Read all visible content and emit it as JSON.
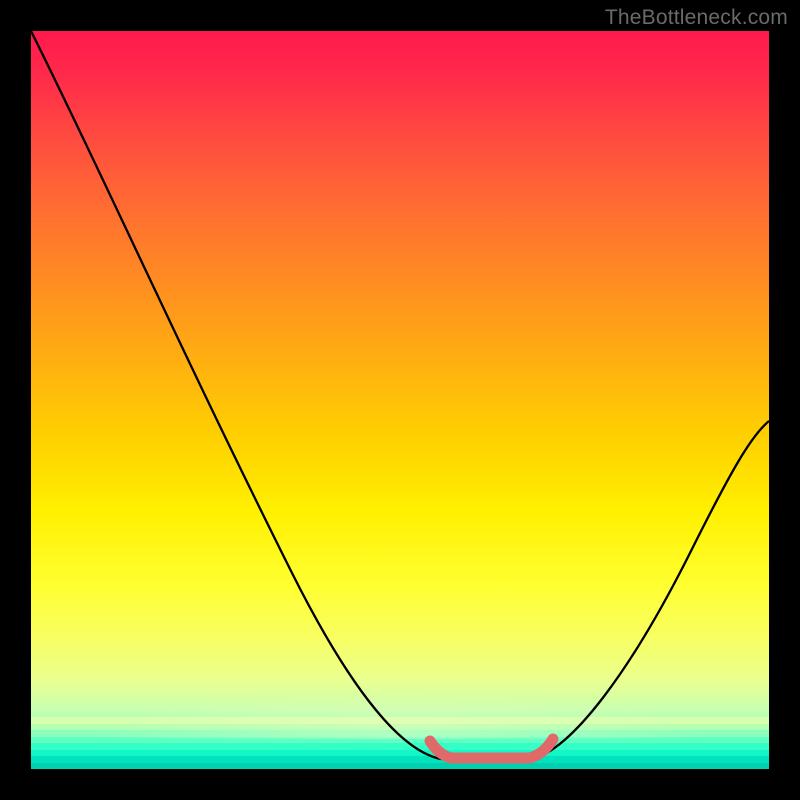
{
  "watermark": "TheBottleneck.com",
  "colors": {
    "frame": "#000000",
    "curve": "#000000",
    "marker": "#e57373",
    "gradient": [
      "#ff1a4d",
      "#ff4d3f",
      "#ff9020",
      "#ffd000",
      "#fff000",
      "#f8ff60",
      "#8effc0",
      "#00ffcc"
    ]
  },
  "chart_data": {
    "type": "line",
    "title": "",
    "xlabel": "",
    "ylabel": "",
    "xlim": [
      0,
      100
    ],
    "ylim": [
      0,
      100
    ],
    "note": "y-axis: red=high (≈100) at top, green=low (≈0) at bottom. The black curve depicts a mismatch/bottleneck score that is high at the left edge (~100), falls steeply to ~0 near x≈58–67 (flat minimum, highlighted), then rises again to ~45 at the right edge.",
    "series": [
      {
        "name": "bottleneck-curve",
        "x": [
          0,
          6,
          12,
          18,
          24,
          30,
          36,
          42,
          48,
          52,
          56,
          58,
          60,
          62,
          64,
          66,
          68,
          72,
          78,
          84,
          90,
          96,
          100
        ],
        "y": [
          100,
          91,
          82,
          72,
          62,
          51,
          40,
          29,
          17,
          10,
          4,
          1,
          0,
          0,
          0,
          0,
          1,
          5,
          13,
          22,
          31,
          40,
          45
        ]
      }
    ],
    "highlight": {
      "name": "optimal-range",
      "x": [
        55,
        57,
        59,
        61,
        63,
        65,
        67,
        69
      ],
      "y": [
        3,
        1.3,
        0.6,
        0.3,
        0.3,
        0.4,
        0.9,
        2.2
      ]
    }
  }
}
